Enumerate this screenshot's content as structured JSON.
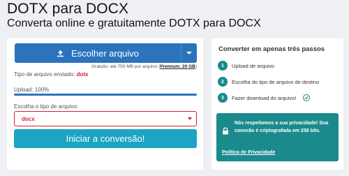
{
  "header": {
    "title": "DOTX para DOCX",
    "subtitle": "Converta online e gratuitamente DOTX para DOCX"
  },
  "steps": [
    "1.",
    "2.",
    "3."
  ],
  "upload": {
    "choose_label": "Escolher arquivo",
    "hint_prefix": "Gratuito: até 750 MB por arquivo (",
    "hint_premium": "Premium: 20 GB",
    "hint_suffix": ")",
    "file_type_label": "Tipo de arquivo enviado:",
    "file_type_value": "dotx",
    "progress_label": "Upload: 100%",
    "progress_percent": 100
  },
  "target": {
    "label": "Escolha o tipo de arquivo:",
    "selected": "docx"
  },
  "start_label": "Iniciar a conversão!",
  "sidebar": {
    "title": "Converter em apenas três passos",
    "steps": [
      {
        "num": "1",
        "label": "Upload de arquivo"
      },
      {
        "num": "2",
        "label": "Escolha do tipo de arquivo de destino"
      },
      {
        "num": "3",
        "label": "Fazer download do arquivo!"
      }
    ],
    "privacy_text": "Nós respeitamos a sua privacidade! Sua conexão é criptografada em 256 bits.",
    "privacy_link": "Política de Privacidade"
  },
  "colors": {
    "primary": "#2b74bd",
    "accent": "#1da3c4",
    "teal": "#1a8a8c",
    "error": "#d3202d"
  }
}
